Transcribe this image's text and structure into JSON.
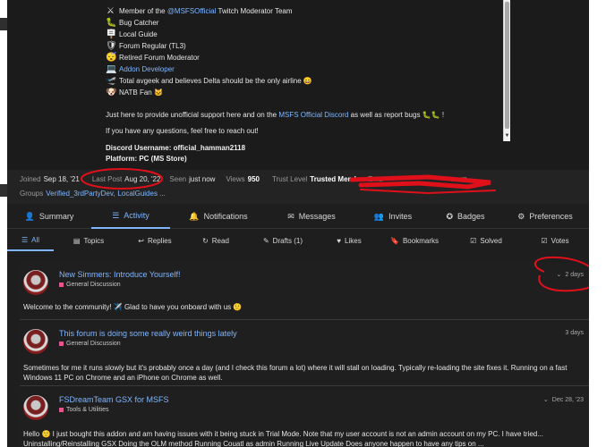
{
  "bio": {
    "badges": [
      {
        "icon": "swords-icon",
        "glyph": "⚔",
        "prefix": "Member of the ",
        "link": "@MSFSOfficial",
        "suffix": " Twitch Moderator Team"
      },
      {
        "icon": "bug-icon",
        "glyph": "🐛",
        "prefix": "Bug Catcher",
        "link": "",
        "suffix": ""
      },
      {
        "icon": "signpost-icon",
        "glyph": "🪧",
        "prefix": "Local Guide",
        "link": "",
        "suffix": ""
      },
      {
        "icon": "shield-icon",
        "glyph": "🛡",
        "prefix": "Forum Regular (TL3)",
        "link": "",
        "suffix": ""
      },
      {
        "icon": "retired-face-icon",
        "glyph": "😴",
        "prefix": "Retired Forum Moderator",
        "link": "",
        "suffix": ""
      },
      {
        "icon": "laptop-icon",
        "glyph": "💻",
        "prefix": "",
        "link": "Addon Developer",
        "suffix": ""
      },
      {
        "icon": "airport-icon",
        "glyph": "🛫",
        "prefix": "Total avgeek and believes Delta should be the only airline ",
        "link": "",
        "suffix": "😄"
      },
      {
        "icon": "dog-face-icon",
        "glyph": "🐶",
        "prefix": "NATB Fan ",
        "link": "",
        "suffix": "🐱"
      }
    ],
    "support_prefix": "Just here to provide unofficial support here and on the ",
    "support_link": "MSFS Official Discord",
    "support_suffix": " as well as report bugs 🐛🐛 !",
    "questions": "If you have any questions, feel free to reach out!",
    "discord": "Discord Username: official_hamman2118",
    "platform": "Platform: PC (MS Store)"
  },
  "meta": {
    "joined_label": "Joined",
    "joined_value": "Sep 18, '21",
    "last_post_label": "Last Post",
    "last_post_value": "Aug 20, '22",
    "seen_label": "Seen",
    "seen_value": "just now",
    "views_label": "Views",
    "views_value": "950",
    "trust_label": "Trust Level",
    "trust_value": "Trusted Membe",
    "email_label": "Ema",
    "email_tail": ".com",
    "groups_label": "Groups",
    "group1": "Verified_3rdPartyDev,",
    "group2": "LocalGuides ..."
  },
  "tabs": [
    {
      "icon": "user-icon",
      "glyph": "👤",
      "label": "Summary",
      "active": false,
      "width": 94
    },
    {
      "icon": "stream-icon",
      "glyph": "☰",
      "label": "Activity",
      "active": true,
      "width": 88
    },
    {
      "icon": "bell-icon",
      "glyph": "🔔",
      "label": "Notifications",
      "active": false,
      "width": 108
    },
    {
      "icon": "envelope-icon",
      "glyph": "✉",
      "label": "Messages",
      "active": false,
      "width": 100
    },
    {
      "icon": "user-plus-icon",
      "glyph": "👥",
      "label": "Invites",
      "active": false,
      "width": 82
    },
    {
      "icon": "certificate-icon",
      "glyph": "✪",
      "label": "Badges",
      "active": false,
      "width": 80
    },
    {
      "icon": "cog-icon",
      "glyph": "⚙",
      "label": "Preferences",
      "active": false,
      "width": 98
    }
  ],
  "subtabs": [
    {
      "icon": "list-icon",
      "glyph": "☰",
      "label": "All",
      "active": true,
      "width": 52
    },
    {
      "icon": "topics-icon",
      "glyph": "▤",
      "label": "Topics",
      "active": false,
      "width": 78
    },
    {
      "icon": "reply-icon",
      "glyph": "↩",
      "label": "Replies",
      "active": false,
      "width": 70
    },
    {
      "icon": "history-icon",
      "glyph": "↻",
      "label": "Read",
      "active": false,
      "width": 66
    },
    {
      "icon": "pencil-icon",
      "glyph": "✎",
      "label": "Drafts (1)",
      "active": false,
      "width": 84
    },
    {
      "icon": "heart-icon",
      "glyph": "♥",
      "label": "Likes",
      "active": false,
      "width": 64
    },
    {
      "icon": "bookmark-icon",
      "glyph": "🔖",
      "label": "Bookmarks",
      "active": false,
      "width": 82
    },
    {
      "icon": "check-icon",
      "glyph": "☑",
      "label": "Solved",
      "active": false,
      "width": 78
    },
    {
      "icon": "check-square-icon",
      "glyph": "☑",
      "label": "Votes",
      "active": false,
      "width": 76
    }
  ],
  "stream": [
    {
      "title": "New Simmers: Introduce Yourself!",
      "category": "General Discussion",
      "category_color": "#e45690",
      "date": "2 days",
      "has_chevron": true,
      "excerpt": "Welcome to the community! ✈️ Glad to have you onboard with us 🙂"
    },
    {
      "title": "This forum is doing some really weird things lately",
      "category": "General Discussion",
      "category_color": "#e45690",
      "date": "3 days",
      "has_chevron": false,
      "excerpt": "Sometimes for me it runs slowly but it's probably once a day (and I check this forum a lot) where it will stall on loading. Typically re-loading the site fixes it. Running on a fast Windows 11 PC on Chrome and an iPhone on Chrome as well."
    },
    {
      "title": "FSDreamTeam GSX for MSFS",
      "category": "Tools & Utilities",
      "category_color": "#e45690",
      "date": "Dec 28, '23",
      "has_chevron": true,
      "excerpt": "Hello 🙂 I just bought this addon and am having issues with it being stuck in Trial Mode. Note that my user account is not an admin account on my PC. I have tried... Uninstalling/Reinstalling GSX Doing the OLM method Running Couatl as admin Running Live Update Does anyone happen to have any tips on ..."
    }
  ],
  "colors": {
    "accent": "#7fb6ff",
    "annotation": "#e0101a"
  }
}
